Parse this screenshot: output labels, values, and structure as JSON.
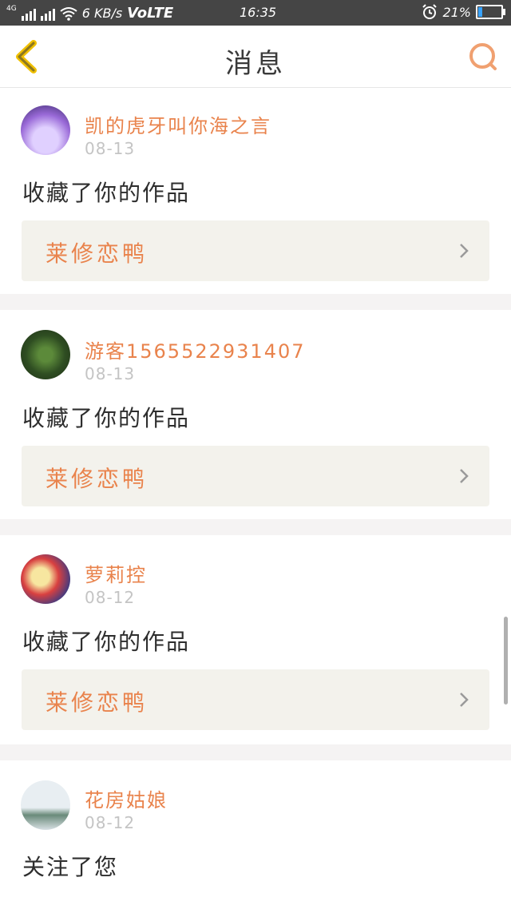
{
  "status_bar": {
    "network": "4G",
    "speed": "6 KB/s",
    "volte": "VoLTE",
    "time": "16:35",
    "battery": "21%",
    "battery_level": 0.21,
    "colors": {
      "background": "#454545",
      "battery_fill": "#38a3ff"
    }
  },
  "header": {
    "title": "消息",
    "back_icon": "chevron-left-icon",
    "search_icon": "search-icon",
    "colors": {
      "back": "#f0c000",
      "search": "#f0a070"
    }
  },
  "messages": [
    {
      "username": "凯的虎牙叫你海之言",
      "date": "08-13",
      "action": "收藏了你的作品",
      "work_title": "莱修恋鸭"
    },
    {
      "username": "游客1565522931407",
      "date": "08-13",
      "action": "收藏了你的作品",
      "work_title": "莱修恋鸭"
    },
    {
      "username": "萝莉控",
      "date": "08-12",
      "action": "收藏了你的作品",
      "work_title": "莱修恋鸭"
    },
    {
      "username": "花房姑娘",
      "date": "08-12",
      "action": "关注了您"
    }
  ],
  "colors": {
    "accent": "#e9834c",
    "date": "#c4c4c4",
    "work_bg": "#f3f2ec",
    "page_bg": "#f5f3f3"
  }
}
